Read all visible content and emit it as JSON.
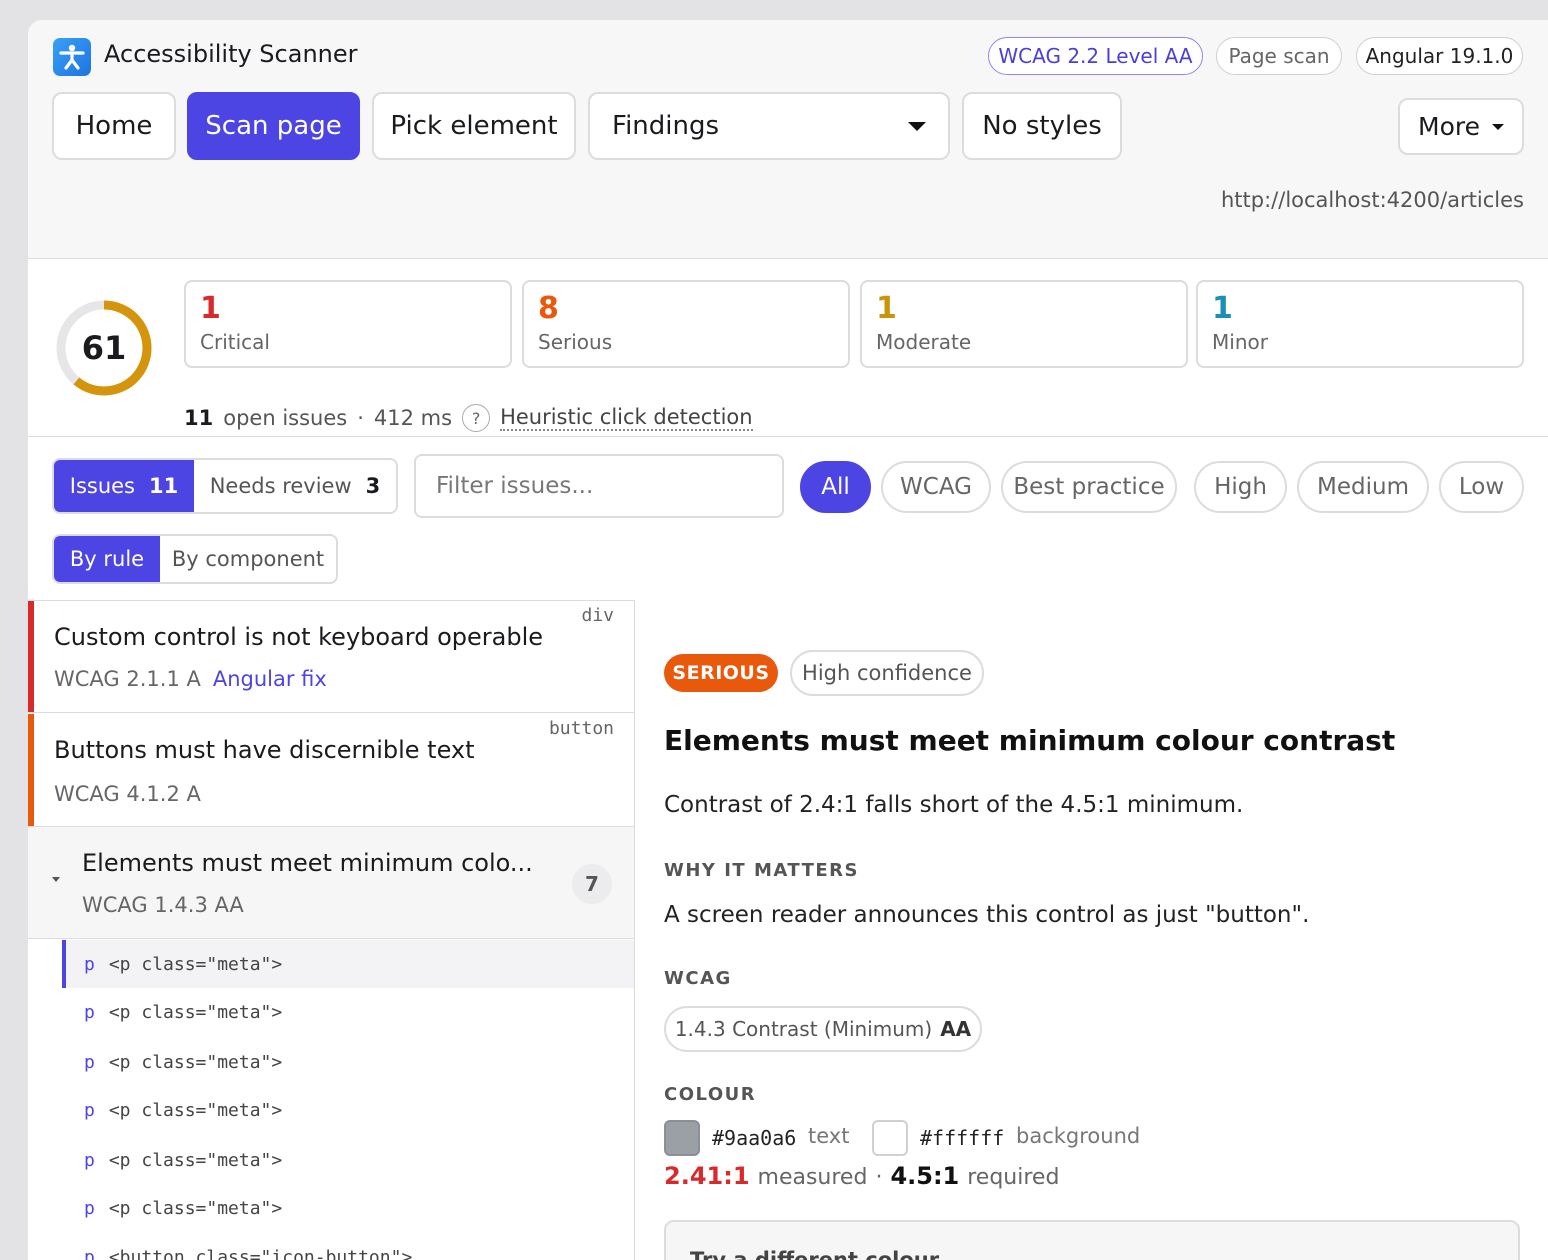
{
  "app": {
    "title": "Accessibility Scanner",
    "standard": "WCAG 2.2 Level AA",
    "scan_mode": "Page scan",
    "framework": "Angular 19.1.0",
    "url": "http://localhost:4200/articles",
    "logo_icon": "accessibility-person-icon"
  },
  "toolbar": {
    "home": "Home",
    "scan": "Scan page",
    "pick": "Pick element",
    "findings": "Findings",
    "no_styles": "No styles",
    "more": "More"
  },
  "summary": {
    "score": "61",
    "score_fraction": 0.61,
    "severities": [
      {
        "count": "1",
        "label": "Critical",
        "color": "#d72b2b"
      },
      {
        "count": "8",
        "label": "Serious",
        "color": "#e8590c"
      },
      {
        "count": "1",
        "label": "Moderate",
        "color": "#c8940a"
      },
      {
        "count": "1",
        "label": "Minor",
        "color": "#1c8fb5"
      }
    ],
    "open_count": "11",
    "open_label": "open issues",
    "separator": "·",
    "duration": "412 ms",
    "help": "?",
    "heuristic": "Heuristic click detection"
  },
  "filters": {
    "issues_label": "Issues",
    "issues_count": "11",
    "review_label": "Needs review",
    "review_count": "3",
    "search_placeholder": "Filter issues...",
    "pills": [
      "All",
      "WCAG",
      "Best practice",
      "High",
      "Medium",
      "Low"
    ],
    "group_by_rule": "By rule",
    "group_by_component": "By component"
  },
  "issues": [
    {
      "title": "Custom control is not keyboard operable",
      "wcag": "WCAG 2.1.1 A",
      "fix": "Angular fix",
      "tag": "div",
      "color": "#d72b2b"
    },
    {
      "title": "Buttons must have discernible text",
      "wcag": "WCAG 4.1.2 A",
      "tag": "button",
      "color": "#e8590c"
    }
  ],
  "group": {
    "title": "Elements must meet minimum colo...",
    "wcag": "WCAG 1.4.3 AA",
    "count": "7",
    "nodes": [
      {
        "tag": "p",
        "code": "<p class=\"meta\">"
      },
      {
        "tag": "p",
        "code": "<p class=\"meta\">"
      },
      {
        "tag": "p",
        "code": "<p class=\"meta\">"
      },
      {
        "tag": "p",
        "code": "<p class=\"meta\">"
      },
      {
        "tag": "p",
        "code": "<p class=\"meta\">"
      },
      {
        "tag": "p",
        "code": "<p class=\"meta\">"
      },
      {
        "tag": "p",
        "code": "<button class=\"icon-button\">"
      }
    ]
  },
  "detail": {
    "severity": "SERIOUS",
    "confidence": "High confidence",
    "title": "Elements must meet minimum colour contrast",
    "description": "Contrast of 2.4:1 falls short of the 4.5:1 minimum.",
    "why_heading": "WHY IT MATTERS",
    "why_text": "A screen reader announces this control as just \"button\".",
    "wcag_heading": "WCAG",
    "wcag_criterion": "1.4.3 Contrast (Minimum)",
    "wcag_level": "AA",
    "colour_heading": "COLOUR",
    "fg_hex": "#9aa0a6",
    "fg_label": "text",
    "bg_hex": "#ffffff",
    "bg_label": "background",
    "measured": "2.41:1",
    "measured_label": "measured",
    "separator": "·",
    "required": "4.5:1",
    "required_label": "required",
    "try_label": "Try a different colour"
  }
}
